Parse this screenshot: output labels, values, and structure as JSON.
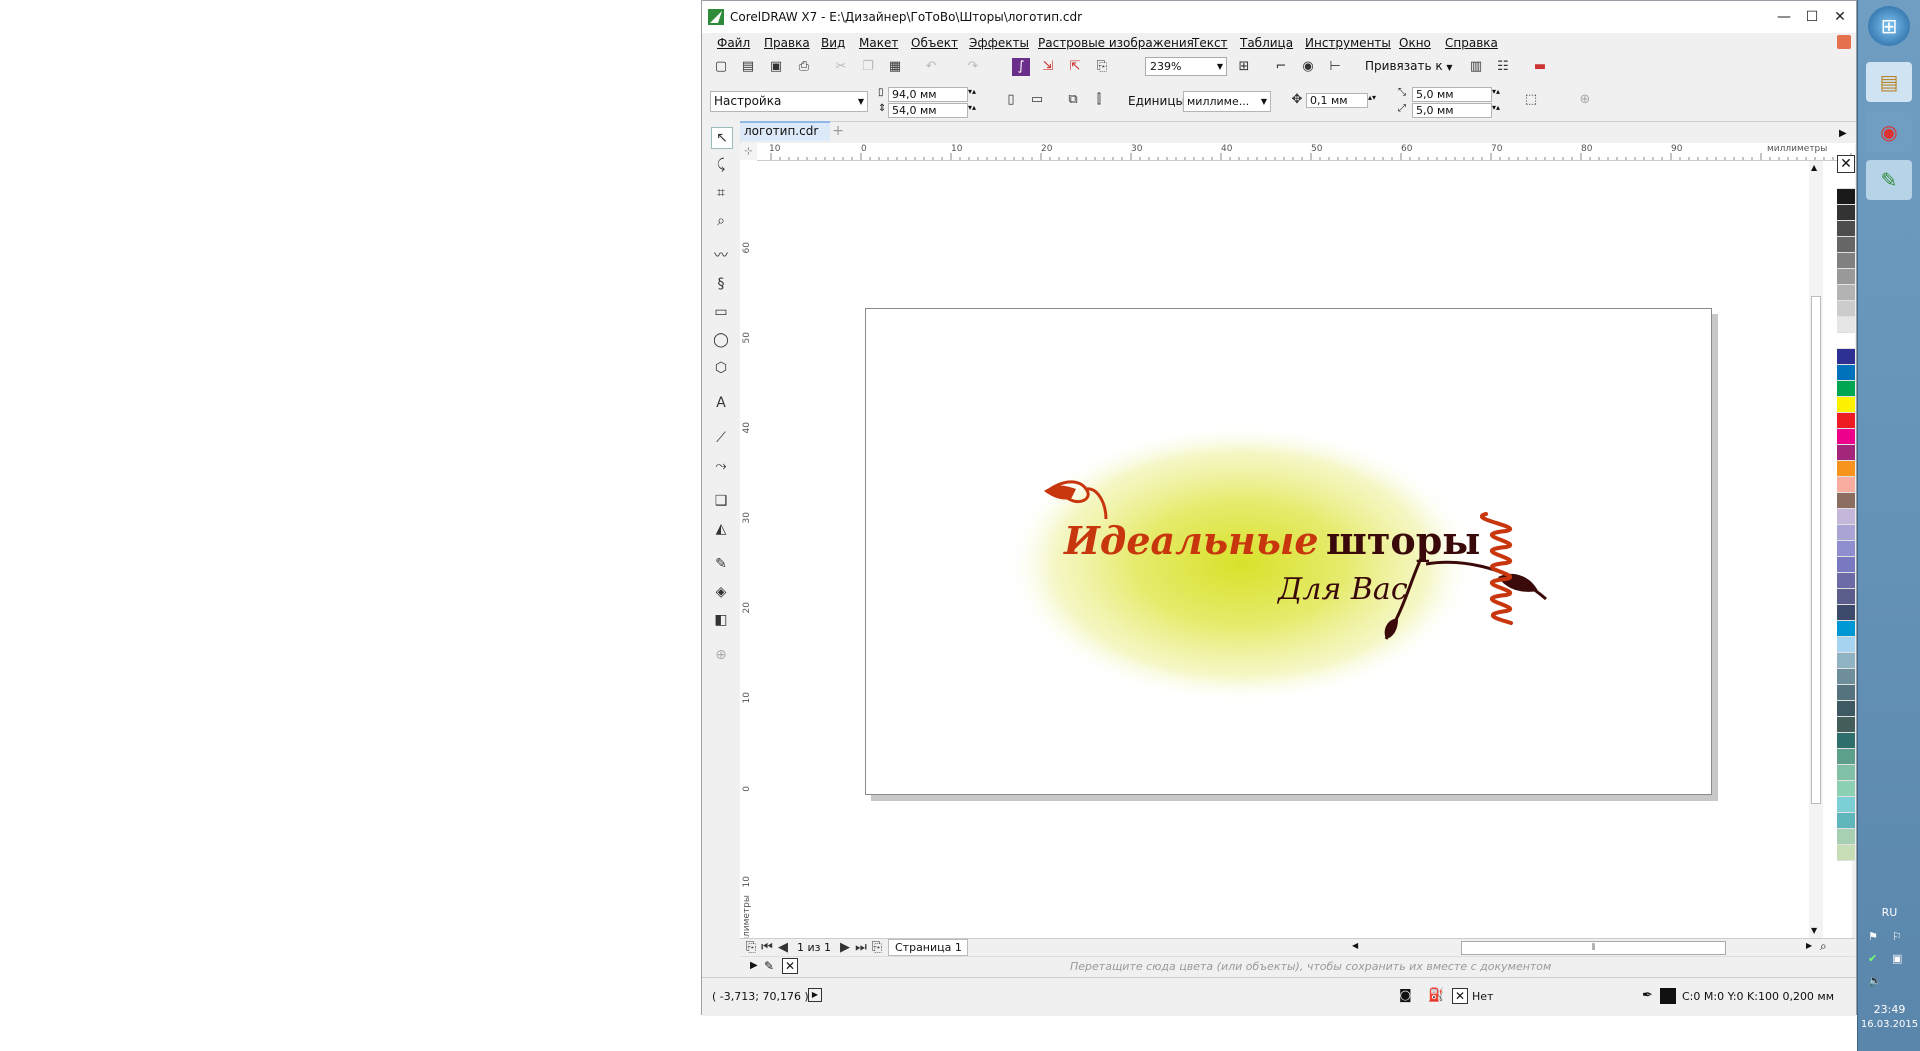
{
  "window": {
    "title": "CorelDRAW X7 - E:\\Дизайнер\\ГоТоВо\\Шторы\\логотип.cdr",
    "minimize": "—",
    "maximize": "☐",
    "close": "✕"
  },
  "menu": [
    "Файл",
    "Правка",
    "Вид",
    "Макет",
    "Объект",
    "Эффекты",
    "Растровые изображения",
    "Текст",
    "Таблица",
    "Инструменты",
    "Окно",
    "Справка"
  ],
  "toolbar1": {
    "zoom": "239%",
    "snap_label": "Привязать к"
  },
  "toolbar2": {
    "preset": "Настройка",
    "width": "94,0 мм",
    "height": "54,0 мм",
    "units_label": "Единицы:",
    "units_value": "миллиме...",
    "nudge": "0,1 мм",
    "dup_x": "5,0 мм",
    "dup_y": "5,0 мм"
  },
  "document_tab": "логотип.cdr",
  "ruler": {
    "unit": "миллиметры",
    "h_ticks": [
      "10",
      "0",
      "10",
      "20",
      "30",
      "40",
      "50",
      "60",
      "70",
      "80",
      "90"
    ],
    "v_ticks": [
      "60",
      "50",
      "40",
      "30",
      "20",
      "10",
      "0",
      "10"
    ]
  },
  "logo": {
    "word1": "Идеальные",
    "word2": "шторы",
    "subtitle": "Для Вас",
    "colors": {
      "orange": "#c8360e",
      "brown": "#3a0a0a",
      "halo": "#e6eb6e"
    }
  },
  "page_nav": {
    "counter": "1 из 1",
    "page_tab": "Страница 1"
  },
  "colorbar_hint": "Перетащите сюда цвета (или объекты), чтобы сохранить их вместе с документом",
  "status": {
    "coords": "( -3,713; 70,176 )",
    "fill": "Нет",
    "outline": "C:0 M:0 Y:0 K:100  0,200 мм"
  },
  "palette": [
    "#ffffff",
    "#1a1a1a",
    "#333333",
    "#4d4d4d",
    "#666666",
    "#808080",
    "#999999",
    "#b3b3b3",
    "#cccccc",
    "#e6e6e6",
    "#ffffff",
    "#2e3192",
    "#0072bc",
    "#00a651",
    "#fff200",
    "#ed1c24",
    "#ec008c",
    "#a3267b",
    "#f7941d",
    "#f9ada0",
    "#8c6d62",
    "#c4b7d9",
    "#a9a4d3",
    "#8f8fcf",
    "#7879c0",
    "#6d6aa8",
    "#5b5d8a",
    "#3d4a6b",
    "#0098d4",
    "#a6d3ef",
    "#8fb3c3",
    "#6f8e9b",
    "#55737e",
    "#3e5962",
    "#445e5c",
    "#2f6f6b",
    "#5e9f8c",
    "#7fc0a7",
    "#8ed0b3",
    "#7ccfd4",
    "#5fb7bc",
    "#a7cfb2",
    "#c6ddb6"
  ],
  "taskbar": {
    "lang": "RU",
    "time": "23:49",
    "date": "16.03.2015"
  }
}
